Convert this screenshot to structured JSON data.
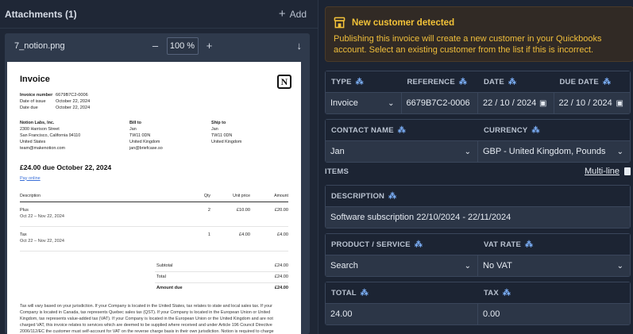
{
  "attachments": {
    "title": "Attachments (1)",
    "add_label": "Add"
  },
  "viewer": {
    "filename": "7_notion.png",
    "zoom_minus": "–",
    "zoom_value": "100",
    "zoom_unit": "%",
    "zoom_plus": "+",
    "download_icon": "↓"
  },
  "invoice": {
    "title": "Invoice",
    "logo": "N",
    "meta": [
      {
        "k": "Invoice number",
        "v": "6679B7C2-0006"
      },
      {
        "k": "Date of issue",
        "v": "October 22, 2024"
      },
      {
        "k": "Date due",
        "v": "October 22, 2024"
      }
    ],
    "from": [
      "Notion Labs, Inc.",
      "2300 Harrison Street",
      "San Francisco, California 94110",
      "United States",
      "team@makenotion.com"
    ],
    "bill_to": {
      "heading": "Bill to",
      "lines": [
        "Jan",
        "TW11 0DN",
        "United Kingdom",
        "jan@briefcase.so"
      ]
    },
    "ship_to": {
      "heading": "Ship to",
      "lines": [
        "Jan",
        "TW11 0DN",
        "United Kingdom"
      ]
    },
    "due_line": "£24.00 due October 22, 2024",
    "pay_online": "Pay online",
    "columns": {
      "desc": "Description",
      "qty": "Qty",
      "unit": "Unit price",
      "amount": "Amount"
    },
    "items": [
      {
        "desc": "Plus",
        "period": "Oct 22 – Nov 22, 2024",
        "qty": "2",
        "unit": "£10.00",
        "amount": "£20.00"
      },
      {
        "desc": "Tax",
        "period": "Oct 22 – Nov 22, 2024",
        "qty": "1",
        "unit": "£4.00",
        "amount": "£4.00"
      }
    ],
    "totals": [
      {
        "label": "Subtotal",
        "value": "£24.00"
      },
      {
        "label": "Total",
        "value": "£24.00"
      },
      {
        "label": "Amount due",
        "value": "£24.00"
      }
    ],
    "footnote": "Tax will vary based on your jurisdiction. If your Company is located in the United States, tax relates to state and local sales tax. If your Company is located in Canada, tax represents Quebec sales tax (QST). If your Company is located in the European Union or United Kingdom, tax represents value-added tax (VAT). If your Company is located in the European Union or the United Kingdom and are not charged VAT, this invoice relates to services which are deemed to be supplied where received and under Article 196 Council Directive 2006/112/EC the customer must self-account for VAT on the reverse charge basis in their own jurisdiction. Notion is required to charge Japanese Consumption Tax (JCT) on services provided to consumers and businesses in Japan. If"
  },
  "alert": {
    "title": "New customer detected",
    "text": "Publishing this invoice will create a new customer in your Quickbooks account. Select an existing customer from the list if this is incorrect.",
    "color": "#f2c238"
  },
  "form": {
    "type": {
      "label": "TYPE",
      "value": "Invoice"
    },
    "reference": {
      "label": "REFERENCE",
      "value": "6679B7C2-0006"
    },
    "date": {
      "label": "DATE",
      "value": "22 / 10 / 2024"
    },
    "due_date": {
      "label": "DUE DATE",
      "value": "22 / 10 / 2024"
    },
    "contact": {
      "label": "CONTACT NAME",
      "value": "Jan"
    },
    "currency": {
      "label": "CURRENCY",
      "value": "GBP - United Kingdom, Pounds"
    },
    "items_label": "ITEMS",
    "multiline_label": "Multi-line",
    "description": {
      "label": "DESCRIPTION",
      "value": "Software subscription 22/10/2024 - 22/11/2024"
    },
    "product": {
      "label": "PRODUCT / SERVICE",
      "value": "Search"
    },
    "vat_rate": {
      "label": "VAT RATE",
      "value": "No VAT"
    },
    "total": {
      "label": "TOTAL",
      "value": "24.00"
    },
    "tax": {
      "label": "TAX",
      "value": "0.00"
    }
  },
  "colors": {
    "accent": "#7fb4ff",
    "warning": "#f2c238",
    "panel": "#2c3647"
  }
}
